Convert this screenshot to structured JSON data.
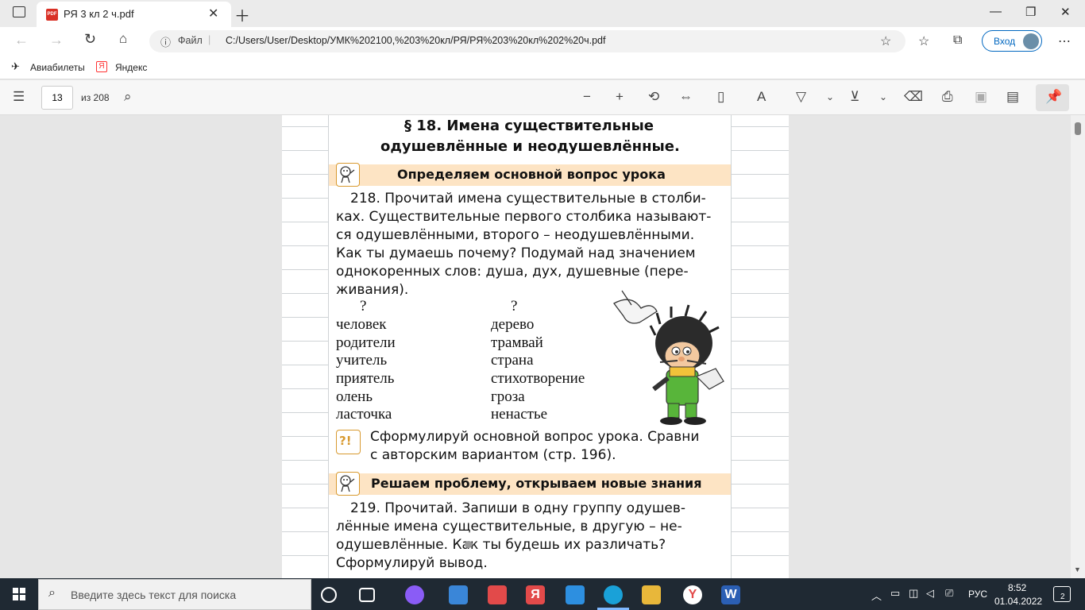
{
  "browser": {
    "tab_title": "РЯ 3 кл 2 ч.pdf",
    "address_prefix": "Файл",
    "url": "C:/Users/User/Desktop/УМК%202100,%203%20кл/РЯ/РЯ%203%20кл%202%20ч.pdf",
    "signin_label": "Вход"
  },
  "bookmarks": [
    {
      "label": "Авиабилеты"
    },
    {
      "label": "Яндекс"
    }
  ],
  "pdf_toolbar": {
    "page_number": "13",
    "page_total": "из 208"
  },
  "document": {
    "section_title_line1": "§ 18. Имена существительные",
    "section_title_line2": "одушевлённые и неодушевлённые.",
    "band1": "Определяем основной вопрос урока",
    "ex218_lines": [
      "218. Прочитай имена существительные в столби-",
      "ках. Существительные первого столбика называют-",
      "ся одушевлёнными, второго – неодушевлёнными.",
      "Как ты думаешь почему? Подумай над значением",
      "однокоренных слов: душа, дух, душевные (пере-",
      "живания)."
    ],
    "col_q1": "?",
    "col_q2": "?",
    "col1": [
      "человек",
      "родители",
      "учитель",
      "приятель",
      "олень",
      "ласточка"
    ],
    "col2": [
      "дерево",
      "трамвай",
      "страна",
      "стихотворение",
      "гроза",
      "ненастье"
    ],
    "hint_icon": "?!",
    "hint_lines": [
      "Сформулируй основной вопрос урока. Сравни",
      "с авторским вариантом (стр. 196)."
    ],
    "band2": "Решаем проблему, открываем новые знания",
    "ex219_lines": [
      "219. Прочитай. Запиши в одну группу одушев-",
      "лённые имена существительные, в другую – не-",
      "одушевлённые.  Как ты будешь их различать?",
      "Сформулируй вывод."
    ]
  },
  "taskbar": {
    "search_placeholder": "Введите здесь текст для поиска",
    "language": "РУС",
    "time": "8:52",
    "date": "01.04.2022",
    "notifications": "2"
  }
}
